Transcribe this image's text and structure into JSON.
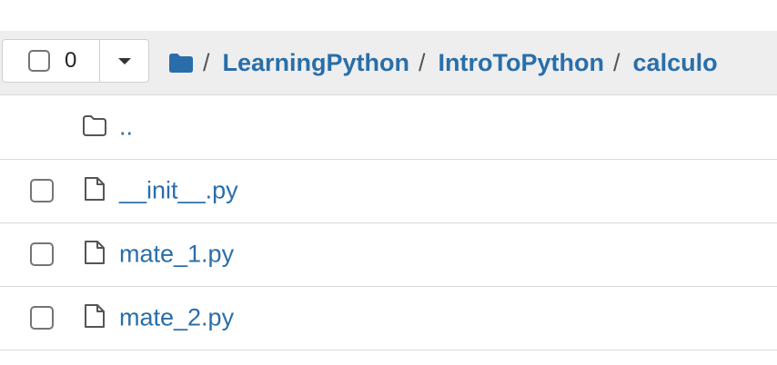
{
  "toolbar": {
    "selected_count": "0"
  },
  "breadcrumb": {
    "separator": "/",
    "items": [
      "LearningPython",
      "IntroToPython",
      "calculo"
    ]
  },
  "files": {
    "parent": {
      "name": "..",
      "icon": "folder-outline-icon"
    },
    "items": [
      {
        "name": "__init__.py",
        "icon": "file-icon"
      },
      {
        "name": "mate_1.py",
        "icon": "file-icon"
      },
      {
        "name": "mate_2.py",
        "icon": "file-icon"
      }
    ]
  },
  "colors": {
    "link": "#296eaa",
    "header_bg": "#eeeeee",
    "divider": "#d9d9d9"
  }
}
